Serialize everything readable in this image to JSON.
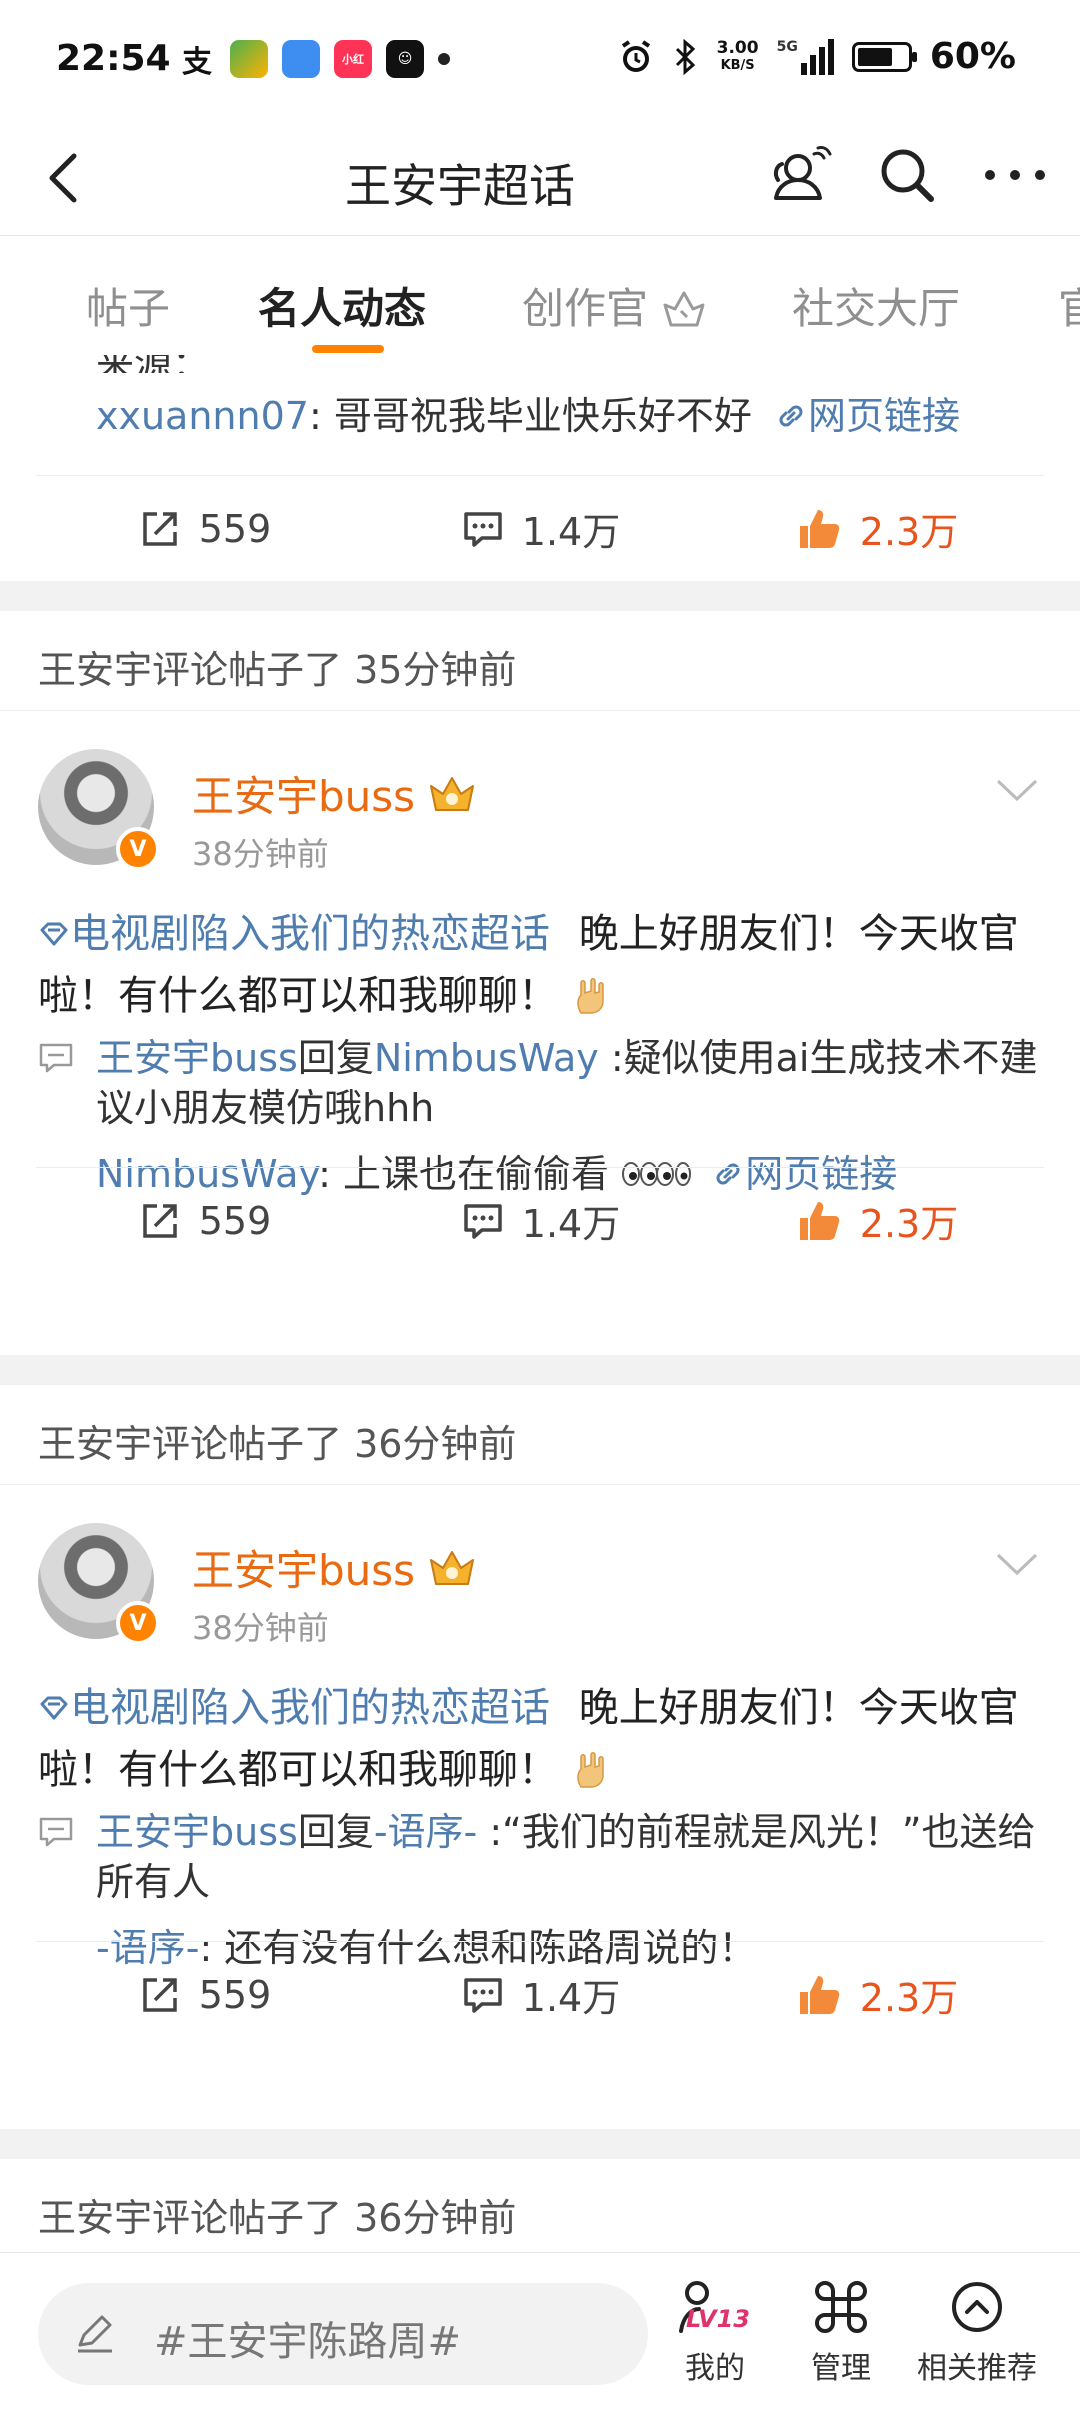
{
  "status_bar": {
    "time": "22:54",
    "speed_value": "3.00",
    "speed_unit": "KB/S",
    "network": "5G",
    "battery": "60%"
  },
  "nav": {
    "title": "王安宇超话"
  },
  "tabs": [
    {
      "label": "帖子"
    },
    {
      "label": "名人动态"
    },
    {
      "label": "创作官"
    },
    {
      "label": "社交大厅"
    },
    {
      "label": "官"
    }
  ],
  "feed": {
    "top_partial": {
      "reply_user": "xxuannn07",
      "reply_text": ": 哥哥祝我毕业快乐好不好",
      "link_text": "网页链接",
      "share_count": "559",
      "comment_count": "1.4万",
      "like_count": "2.3万"
    },
    "sections": [
      {
        "header": "王安宇评论帖子了 35分钟前",
        "author": "王安宇buss",
        "time": "38分钟前",
        "topic": "电视剧陷入我们的热恋超话",
        "content": "晚上好朋友们！今天收官啦！有什么都可以和我聊聊！",
        "reply_from": "王安宇buss",
        "reply_verb": "回复",
        "reply_to": "NimbusWay",
        "reply_text": " :疑似使用ai生成技术不建议小朋友模仿哦hhh",
        "orig_user": "NimbusWay",
        "orig_text": ": 上课也在偷偷看",
        "orig_link": "网页链接",
        "share_count": "559",
        "comment_count": "1.4万",
        "like_count": "2.3万"
      },
      {
        "header": "王安宇评论帖子了 36分钟前",
        "author": "王安宇buss",
        "time": "38分钟前",
        "topic": "电视剧陷入我们的热恋超话",
        "content": "晚上好朋友们！今天收官啦！有什么都可以和我聊聊！",
        "reply_from": "王安宇buss",
        "reply_verb": "回复",
        "reply_to": "-语序-",
        "reply_text": " :“我们的前程就是风光！”也送给所有人",
        "orig_user": "-语序-",
        "orig_text": ": 还有没有什么想和陈路周说的！",
        "share_count": "559",
        "comment_count": "1.4万",
        "like_count": "2.3万"
      }
    ],
    "last_header": "王安宇评论帖子了 36分钟前"
  },
  "bottom_bar": {
    "compose_placeholder": "#王安宇陈路周#",
    "level_badge": "LV13",
    "my_label": "我的",
    "manage_label": "管理",
    "recommend_label": "相关推荐"
  },
  "colors": {
    "accent": "#ff8200",
    "author": "#e86a12",
    "link": "#507daf",
    "like": "#e8541e"
  }
}
